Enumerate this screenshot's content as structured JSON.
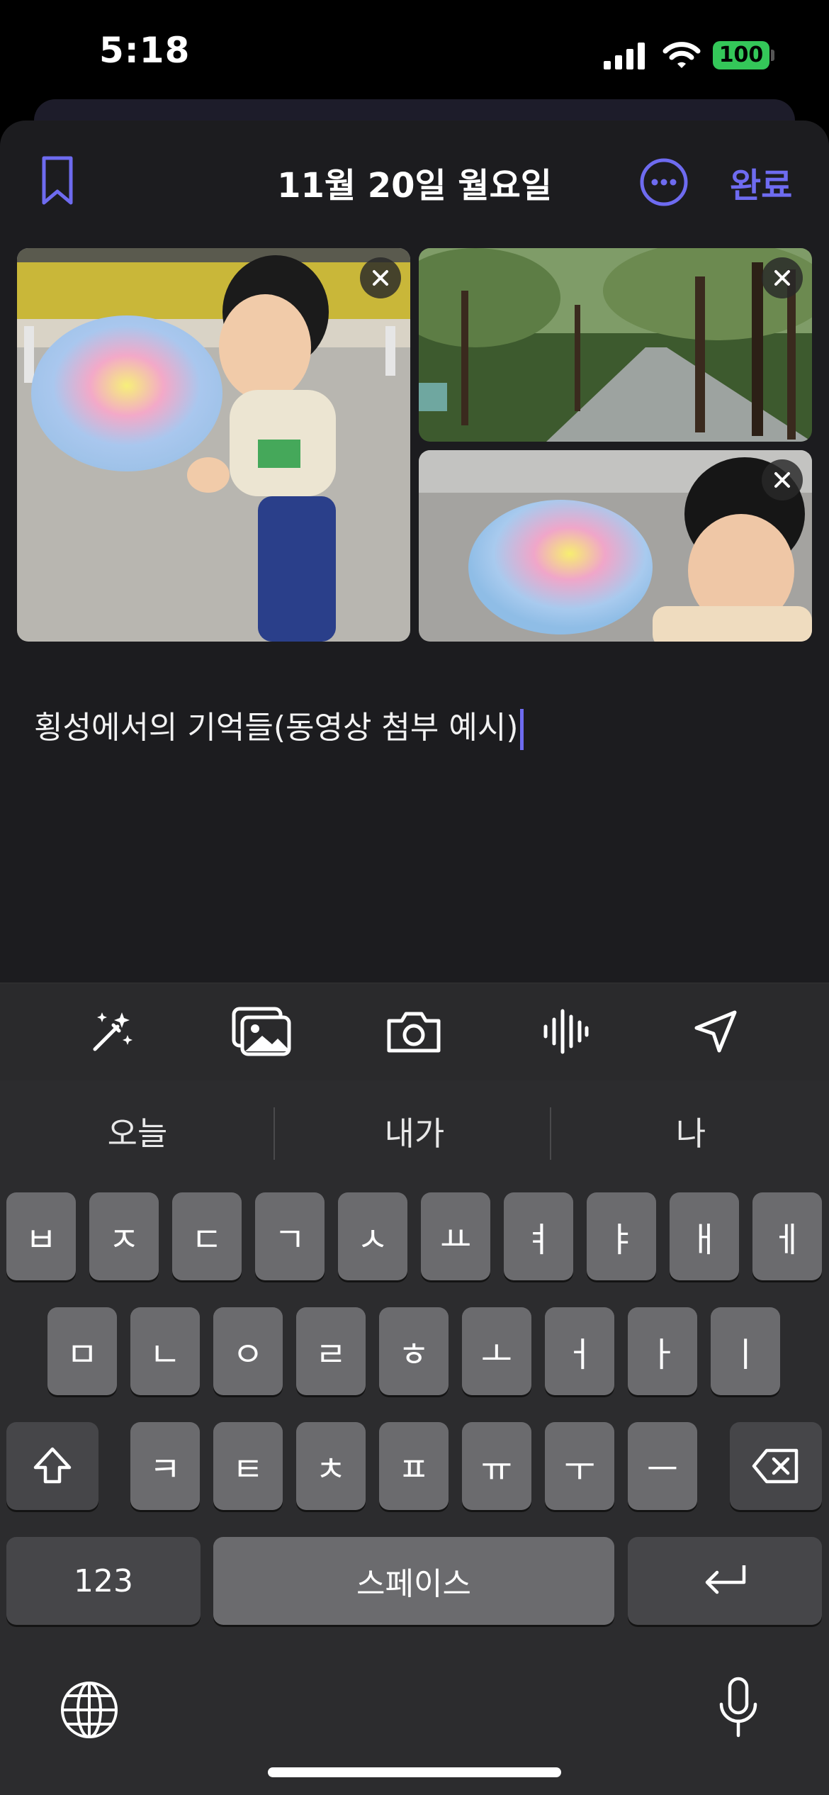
{
  "status_bar": {
    "time": "5:18",
    "battery": "100"
  },
  "header": {
    "date_title": "11월 20일 월요일",
    "done_label": "완료"
  },
  "note": {
    "text": "횡성에서의 기억들(동영상 첨부 예시)"
  },
  "toolbar": {
    "icons": [
      "magic-wand-icon",
      "photo-library-icon",
      "camera-icon",
      "audio-waveform-icon",
      "location-arrow-icon"
    ]
  },
  "keyboard": {
    "suggestions": [
      "오늘",
      "내가",
      "나"
    ],
    "row1": [
      "ㅂ",
      "ㅈ",
      "ㄷ",
      "ㄱ",
      "ㅅ",
      "ㅛ",
      "ㅕ",
      "ㅑ",
      "ㅐ",
      "ㅔ"
    ],
    "row2": [
      "ㅁ",
      "ㄴ",
      "ㅇ",
      "ㄹ",
      "ㅎ",
      "ㅗ",
      "ㅓ",
      "ㅏ",
      "ㅣ"
    ],
    "row3": [
      "ㅋ",
      "ㅌ",
      "ㅊ",
      "ㅍ",
      "ㅠ",
      "ㅜ",
      "ㅡ"
    ],
    "numbers_label": "123",
    "space_label": "스페이스"
  },
  "colors": {
    "accent": "#6e6bf0",
    "battery": "#34c759"
  }
}
